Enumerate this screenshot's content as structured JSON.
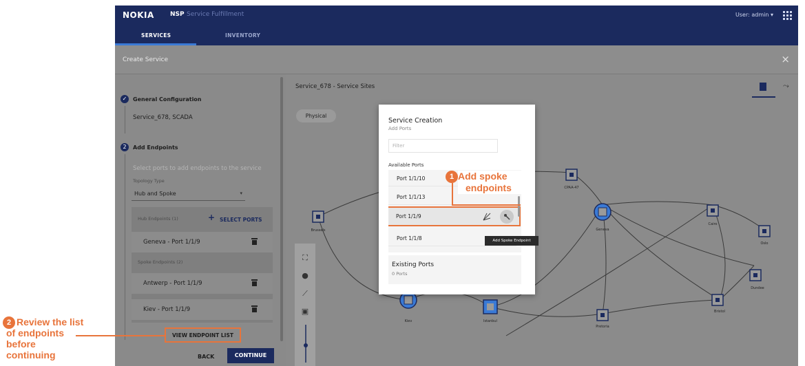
{
  "topbar": {
    "brand": "NOKIA",
    "app": "NSP",
    "product": "Service Fulfillment",
    "user": "User: admin ▾"
  },
  "tabs": [
    {
      "label": "SERVICES",
      "active": true
    },
    {
      "label": "INVENTORY",
      "active": false
    }
  ],
  "page": {
    "title": "Create Service",
    "close": "×"
  },
  "wizard": {
    "step1": {
      "title": "General Configuration",
      "summary": "Service_678, SCADA"
    },
    "step2": {
      "number": "2",
      "title": "Add Endpoints",
      "hint": "Select ports to add endpoints to the service",
      "topology_label": "Topology Type",
      "topology_value": "Hub and Spoke",
      "hub_header": "Hub Endpoints (1)",
      "select_ports": "SELECT PORTS",
      "hub_items": [
        "Geneva - Port 1/1/9"
      ],
      "spoke_header": "Spoke Endpoints (2)",
      "spoke_items": [
        "Antwerp - Port 1/1/9",
        "Kiev - Port 1/1/9"
      ],
      "view_list": "VIEW ENDPOINT LIST",
      "back": "BACK",
      "continue": "CONTINUE"
    }
  },
  "map": {
    "title": "Service_678 - Service Sites",
    "filter_chip": "Physical",
    "nodes": [
      "Brussels",
      "CPAA-47",
      "Geneva",
      "Cairo",
      "Oslo",
      "Dundee",
      "Bristol",
      "Pretoria",
      "Istanbul",
      "Kiev"
    ]
  },
  "modal": {
    "title": "Service Creation",
    "subtitle": "Add Ports",
    "filter_placeholder": "Filter",
    "available_label": "Available Ports",
    "ports": [
      "Port 1/1/10",
      "Port 1/1/13",
      "Port 1/1/9",
      "Port 1/1/8"
    ],
    "tooltip": "Add Spoke Endpoint",
    "existing_title": "Existing Ports",
    "existing_count": "0 Ports"
  },
  "callouts": {
    "one": {
      "num": "1",
      "line1": "Add spoke",
      "line2": "endpoints"
    },
    "two": {
      "num": "2",
      "line1": "Review the list",
      "line2": "of endpoints",
      "line3": "before",
      "line4": "continuing"
    }
  },
  "colors": {
    "navy": "#1b2a5e",
    "accent": "#e8743b",
    "overlay_gray": "#8a8a8a"
  }
}
